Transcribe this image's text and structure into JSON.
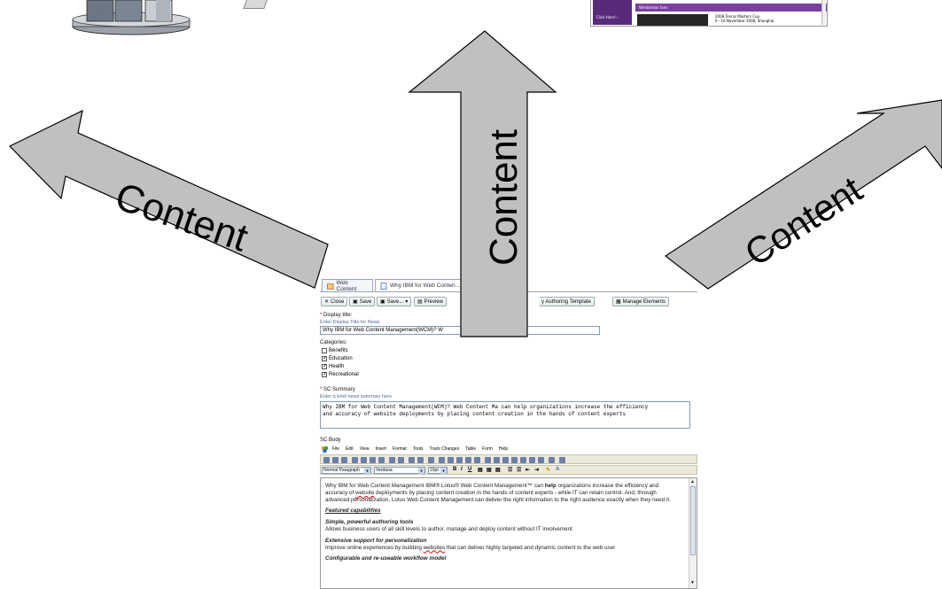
{
  "colors": {
    "arrow_fill": "#c0c0c0",
    "arrow_stroke": "#000000",
    "purple_banner": "#7b3fa0",
    "tab_border": "#9aa6b8",
    "hint_text": "#4a6a9a"
  },
  "thumbnail": {
    "banner_text": "Wimbledon fans",
    "left_link": "Click Here! ›",
    "news_line1": "2008 Tennis Masters Cup",
    "news_line2": "9 - 16 November 2008, Shanghai"
  },
  "arrows": {
    "left_label": "Content",
    "middle_label": "Content",
    "right_label": "Content"
  },
  "cms": {
    "tabs": [
      {
        "label": "Web Content",
        "icon": "web-content-icon"
      },
      {
        "label": "Why IBM for Web Conten...",
        "icon": "document-icon"
      }
    ],
    "toolbar": {
      "close": "Close",
      "save": "Save",
      "save_menu": "Save...",
      "preview": "Preview",
      "authoring_template": "y Authoring Template",
      "manage_elements": "Manage Elements"
    },
    "display_title": {
      "required": "*",
      "label": "Display title:",
      "hint": "Enter Display Title for News",
      "value": "Why IBM for Web Content Management(WCM)? W"
    },
    "categories": {
      "label": "Categories:",
      "items": [
        {
          "label": "Benefits",
          "checked": false
        },
        {
          "label": "Education",
          "checked": true
        },
        {
          "label": "Health",
          "checked": true
        },
        {
          "label": "Recreational",
          "checked": true
        }
      ]
    },
    "summary": {
      "required": "*",
      "label": "SC Summary",
      "hint": "Enter a brief news summary here",
      "line1": "Why IBM for Web Content Management(WCM)? Web Content Ma can help organizations increase the efficiency",
      "line2": "and accuracy of website deployments by placing content creation in the hands of content experts"
    },
    "body": {
      "label": "SC Body",
      "menu": [
        "File",
        "Edit",
        "View",
        "Insert",
        "Format",
        "Tools",
        "Track Changes",
        "Table",
        "Form",
        "Help"
      ],
      "paragraph_style": "Normal Paragraph",
      "font": "Verdana",
      "size": "10pt",
      "bold": "B",
      "italic": "I",
      "underline": "U",
      "intro_a": "Why IBM for Web Content Management IBM® Lotus® Web Content Management™ can ",
      "intro_help": "help",
      "intro_b": " organizations increase the efficiency and accuracy of ",
      "intro_website": "website",
      "intro_c": " deployments by placing content creation in the hands of content experts - while IT can retain control. And, through advanced personalization, Lotus Web Content Management can deliver the right information to the right audience exactly when they need it.",
      "featured": "Featured capabilities",
      "h1": "Simple, powerful authoring tools",
      "p1": "Allows business users of all skill levels to author, manage and deploy content without IT involvement",
      "h2": "Extensive support for personalization",
      "p2a": "Improve online experiences by building ",
      "p2_websites": "websites",
      "p2b": " that can deliver highly targeted and dynamic content to the web user",
      "h3": "Configurable and re-useable workflow model"
    }
  }
}
